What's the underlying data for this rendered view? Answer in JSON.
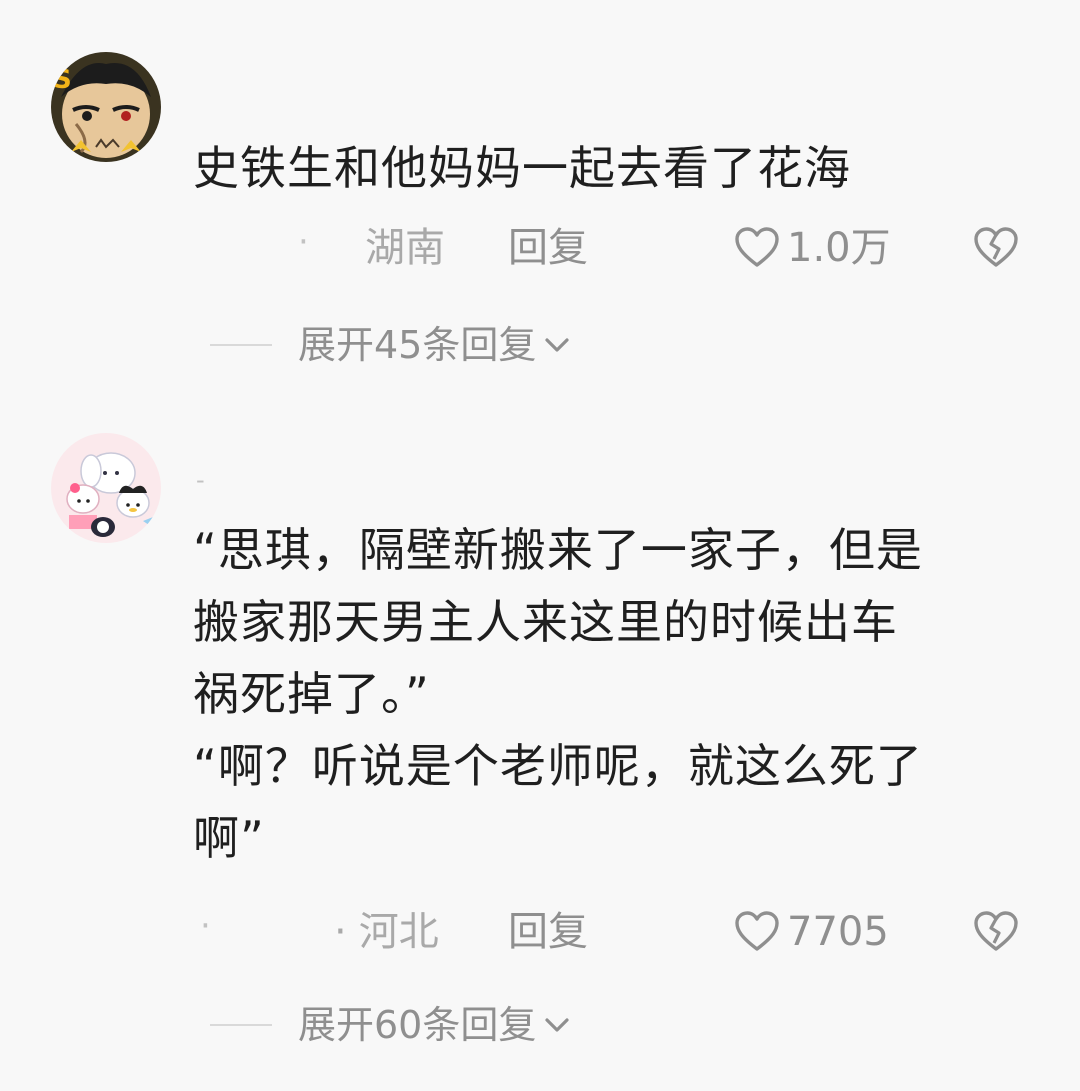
{
  "comments": [
    {
      "text": "史铁生和他妈妈一起去看了花海",
      "region": "湖南",
      "reply_label": "回复",
      "likes": "1.0万",
      "expand_label": "展开45条回复",
      "avatar": "anime-character-avatar"
    },
    {
      "text": "“思琪，隔壁新搬来了一家子，但是\n搬家那天男主人来这里的时候出车\n祸死掉了。”\n“啊？听说是个老师呢，就这么死了\n啊”",
      "region": "河北",
      "region_prefix": "·",
      "reply_label": "回复",
      "likes": "7705",
      "expand_label": "展开60条回复",
      "avatar": "cartoon-characters-avatar"
    }
  ],
  "colors": {
    "text": "#1f1f1f",
    "meta": "#8f8f8f",
    "region": "#a9a9a9",
    "background": "#f8f8f8"
  },
  "icons": [
    "heart-outline-icon",
    "broken-heart-icon",
    "chevron-down-icon"
  ]
}
